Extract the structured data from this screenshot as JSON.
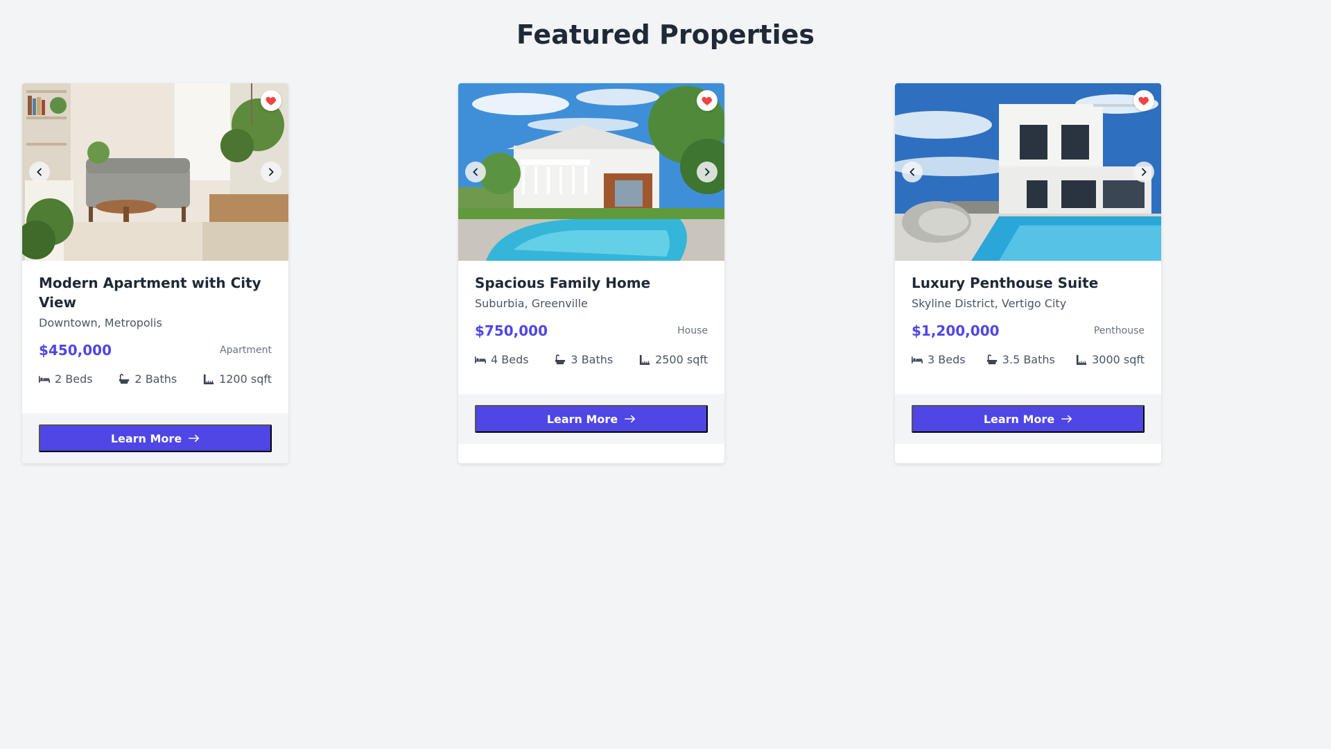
{
  "page": {
    "title": "Featured Properties"
  },
  "colors": {
    "accent": "#4f46e5",
    "heart": "#ef4444",
    "background": "#f3f4f6"
  },
  "icons": {
    "favorite": "heart-icon",
    "prev": "chevron-left-icon",
    "next": "chevron-right-icon",
    "beds": "bed-icon",
    "baths": "bath-icon",
    "area": "ruler-icon",
    "cta": "arrow-right-icon"
  },
  "properties": [
    {
      "title": "Modern Apartment with City View",
      "location": "Downtown, Metropolis",
      "price": "$450,000",
      "type": "Apartment",
      "beds": "2 Beds",
      "baths": "2 Baths",
      "area": "1200 sqft",
      "cta": "Learn More"
    },
    {
      "title": "Spacious Family Home",
      "location": "Suburbia, Greenville",
      "price": "$750,000",
      "type": "House",
      "beds": "4 Beds",
      "baths": "3 Baths",
      "area": "2500 sqft",
      "cta": "Learn More"
    },
    {
      "title": "Luxury Penthouse Suite",
      "location": "Skyline District, Vertigo City",
      "price": "$1,200,000",
      "type": "Penthouse",
      "beds": "3 Beds",
      "baths": "3.5 Baths",
      "area": "3000 sqft",
      "cta": "Learn More"
    }
  ]
}
